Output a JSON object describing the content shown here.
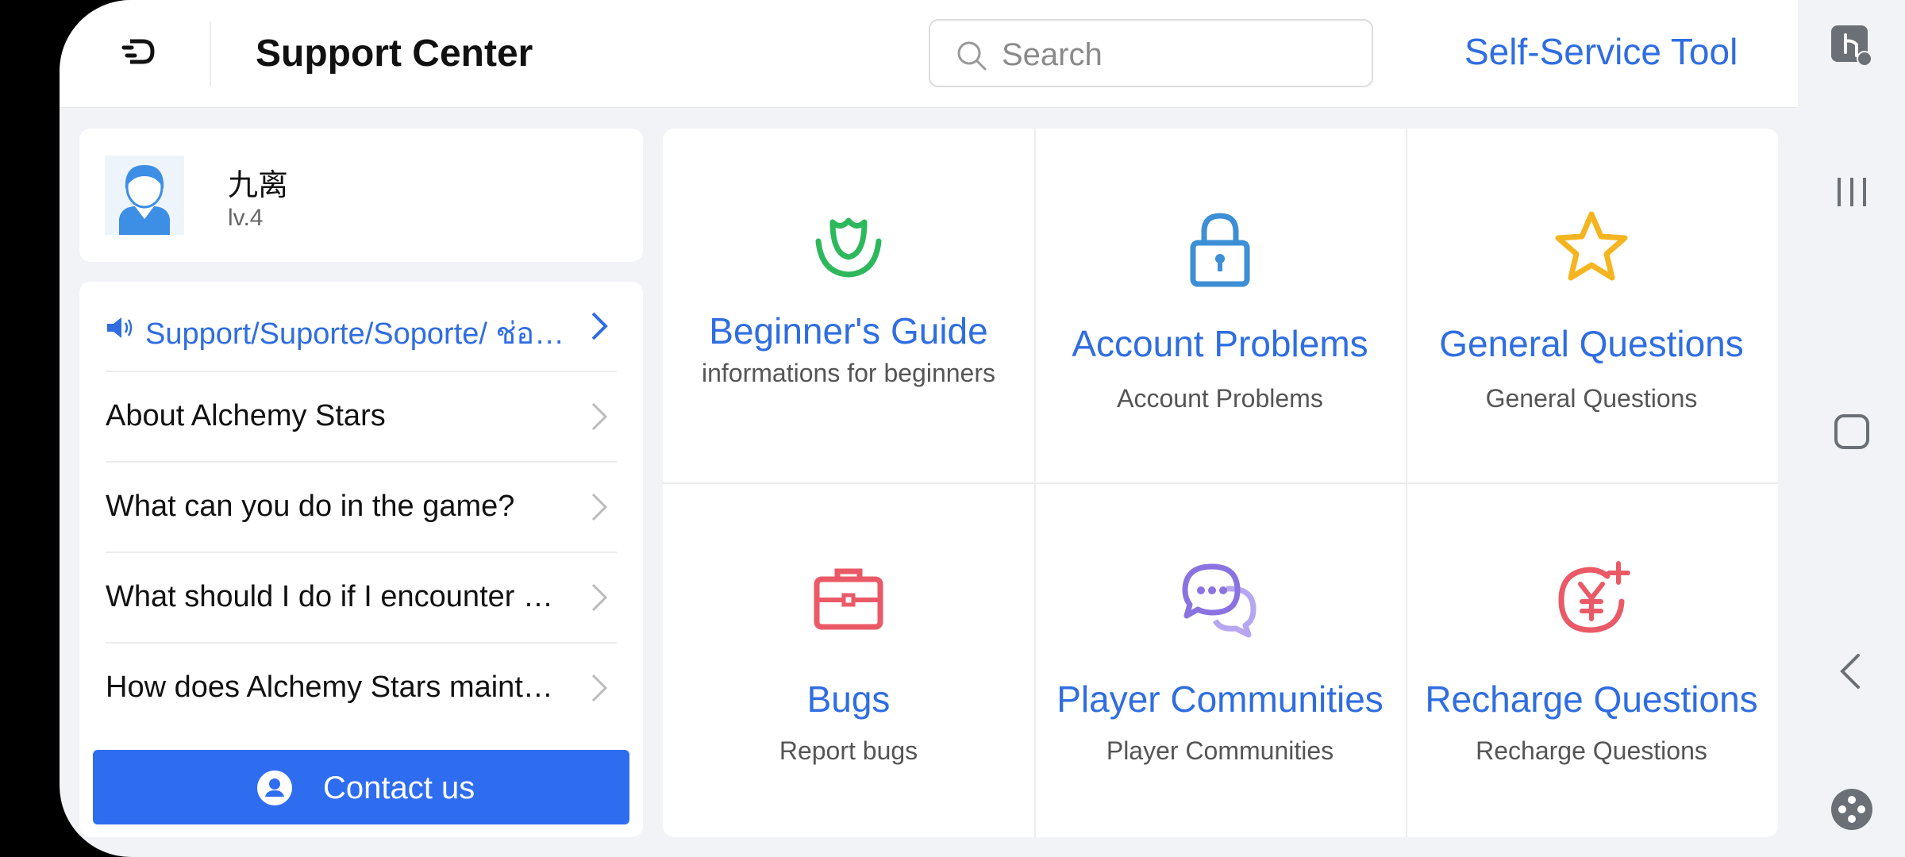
{
  "header": {
    "title": "Support Center",
    "search_placeholder": "Search",
    "self_service": "Self-Service Tool"
  },
  "profile": {
    "name": "九离",
    "level": "lv.4"
  },
  "faq": {
    "notice": "Support/Suporte/Soporte/ ช่องทางติดต่อ",
    "items": [
      "About Alchemy Stars",
      "What can you do in the game?",
      "What should I do if I encounter problems?",
      "How does Alchemy Stars maintain fairness?"
    ],
    "contact_label": "Contact us"
  },
  "categories": [
    {
      "title": "Beginner's Guide",
      "subtitle": "informations for beginners",
      "icon": "tulip-icon",
      "color": "#2db85c"
    },
    {
      "title": "Account Problems",
      "subtitle": "Account Problems",
      "icon": "lock-icon",
      "color": "#3d8fd6"
    },
    {
      "title": "General Questions",
      "subtitle": "General Questions",
      "icon": "star-icon",
      "color": "#f5b520"
    },
    {
      "title": "Bugs",
      "subtitle": "Report bugs",
      "icon": "briefcase-icon",
      "color": "#ea5a66"
    },
    {
      "title": "Player Communities",
      "subtitle": "Player Communities",
      "icon": "chat-bubbles-icon",
      "color": "#8a73e0"
    },
    {
      "title": "Recharge Questions",
      "subtitle": "Recharge Questions",
      "icon": "yen-plus-icon",
      "color": "#ea5a66"
    }
  ],
  "colors": {
    "accent": "#2f6de1",
    "button": "#2f6df0",
    "background": "#f1f3f6"
  }
}
